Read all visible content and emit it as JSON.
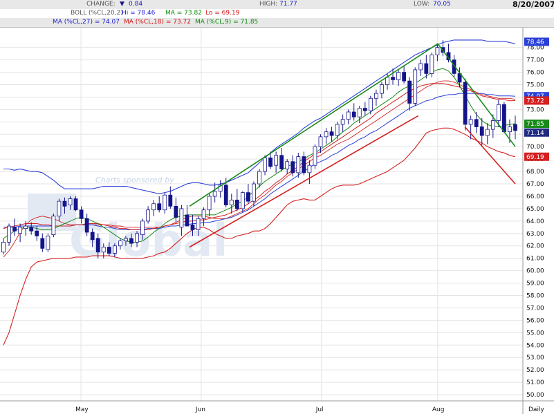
{
  "header": {
    "change_label": "CHANGE:",
    "change_value": "0.84",
    "high_label": "HIGH:",
    "high_value": "71.77",
    "low_label": "LOW:",
    "low_value": "70.05",
    "date": "8/20/2007",
    "boll_label": "BOLL (%CL,20,2)",
    "boll_hi": "Hi = 78.46",
    "boll_ma": "MA = 73.82",
    "boll_lo": "Lo = 69.19",
    "ma27": "MA (%CL,27) = 74.07",
    "ma18": "MA (%CL,18) = 73.72",
    "ma9": "MA (%CL,9) = 71.85"
  },
  "watermark": {
    "sponsor_text": "Charts sponsored by",
    "brand_text": "Global"
  },
  "chart_data": {
    "type": "candlestick",
    "x_labels": [
      "May",
      "Jun",
      "Jul",
      "Aug",
      "Daily"
    ],
    "y_ticks": [
      "50.00",
      "51.00",
      "52.00",
      "53.00",
      "54.00",
      "55.00",
      "56.00",
      "57.00",
      "58.00",
      "59.00",
      "60.00",
      "61.00",
      "62.00",
      "63.00",
      "64.00",
      "65.00",
      "66.00",
      "67.00",
      "68.00",
      "69.00",
      "70.00",
      "71.00",
      "72.00",
      "73.00",
      "74.00",
      "75.00",
      "76.00",
      "77.00",
      "78.00"
    ],
    "ylim": [
      49.5,
      79.6
    ],
    "grid": true,
    "candles": [
      [
        61.5,
        62.6,
        61.3,
        62.3
      ],
      [
        62.3,
        63.8,
        62.0,
        63.6
      ],
      [
        63.5,
        64.2,
        62.8,
        63.2
      ],
      [
        63.0,
        63.8,
        62.3,
        63.5
      ],
      [
        63.4,
        64.0,
        62.8,
        63.6
      ],
      [
        63.5,
        63.9,
        62.9,
        63.2
      ],
      [
        63.2,
        63.6,
        62.4,
        62.8
      ],
      [
        62.6,
        63.0,
        61.5,
        61.8
      ],
      [
        61.7,
        63.0,
        61.5,
        62.8
      ],
      [
        62.9,
        64.6,
        62.7,
        64.4
      ],
      [
        64.4,
        65.8,
        64.0,
        65.6
      ],
      [
        65.6,
        65.9,
        64.6,
        65.2
      ],
      [
        65.3,
        66.0,
        64.9,
        65.8
      ],
      [
        65.8,
        66.0,
        64.8,
        64.9
      ],
      [
        64.9,
        65.2,
        63.8,
        64.2
      ],
      [
        64.2,
        64.6,
        62.8,
        63.1
      ],
      [
        63.1,
        63.4,
        61.9,
        62.5
      ],
      [
        62.6,
        63.0,
        61.0,
        61.5
      ],
      [
        61.5,
        62.2,
        61.0,
        61.9
      ],
      [
        61.9,
        62.3,
        61.2,
        61.4
      ],
      [
        61.4,
        62.2,
        61.1,
        62.0
      ],
      [
        62.0,
        62.6,
        61.7,
        62.4
      ],
      [
        62.4,
        62.8,
        62.0,
        62.6
      ],
      [
        62.6,
        63.0,
        61.9,
        62.2
      ],
      [
        62.3,
        63.2,
        61.9,
        63.0
      ],
      [
        62.9,
        64.2,
        62.5,
        64.0
      ],
      [
        64.0,
        65.2,
        63.8,
        64.9
      ],
      [
        64.9,
        65.7,
        64.4,
        65.4
      ],
      [
        65.4,
        66.0,
        64.7,
        64.9
      ],
      [
        64.9,
        66.3,
        64.6,
        66.1
      ],
      [
        66.1,
        66.8,
        65.0,
        65.2
      ],
      [
        65.2,
        65.9,
        63.9,
        64.3
      ],
      [
        63.5,
        65.3,
        62.8,
        65.0
      ],
      [
        64.5,
        65.3,
        63.8,
        63.6
      ],
      [
        63.7,
        64.5,
        62.8,
        63.3
      ],
      [
        63.3,
        64.4,
        62.8,
        64.2
      ],
      [
        64.2,
        65.1,
        63.6,
        64.9
      ],
      [
        64.9,
        66.2,
        64.4,
        66.0
      ],
      [
        66.0,
        67.1,
        65.5,
        66.4
      ],
      [
        66.4,
        67.3,
        65.9,
        66.9
      ],
      [
        66.9,
        67.5,
        65.1,
        65.3
      ],
      [
        65.3,
        66.2,
        64.6,
        65.7
      ],
      [
        65.7,
        66.6,
        64.8,
        65.0
      ],
      [
        65.0,
        66.4,
        64.7,
        66.3
      ],
      [
        66.3,
        67.0,
        65.4,
        65.6
      ],
      [
        65.6,
        67.2,
        65.2,
        67.0
      ],
      [
        67.0,
        68.2,
        66.7,
        68.0
      ],
      [
        68.0,
        69.3,
        67.7,
        69.1
      ],
      [
        69.1,
        69.6,
        68.2,
        68.4
      ],
      [
        68.5,
        69.6,
        67.9,
        69.3
      ],
      [
        69.3,
        69.9,
        68.0,
        68.2
      ],
      [
        68.2,
        69.0,
        67.8,
        68.8
      ],
      [
        68.8,
        69.3,
        67.6,
        67.9
      ],
      [
        67.9,
        69.5,
        67.5,
        69.2
      ],
      [
        69.2,
        69.6,
        67.7,
        67.9
      ],
      [
        67.9,
        68.9,
        67.0,
        68.5
      ],
      [
        68.5,
        70.2,
        68.2,
        70.0
      ],
      [
        70.0,
        71.0,
        69.5,
        70.8
      ],
      [
        70.8,
        71.5,
        70.2,
        71.2
      ],
      [
        71.2,
        71.6,
        70.4,
        70.9
      ],
      [
        70.9,
        72.0,
        70.6,
        71.8
      ],
      [
        71.8,
        72.6,
        71.2,
        72.2
      ],
      [
        72.2,
        73.0,
        71.8,
        72.8
      ],
      [
        72.8,
        73.5,
        72.1,
        72.4
      ],
      [
        72.4,
        73.3,
        71.9,
        73.1
      ],
      [
        73.1,
        73.6,
        72.5,
        72.9
      ],
      [
        72.9,
        74.1,
        72.6,
        73.9
      ],
      [
        73.9,
        74.6,
        73.3,
        74.3
      ],
      [
        74.3,
        75.2,
        73.9,
        75.0
      ],
      [
        75.0,
        75.9,
        74.6,
        75.6
      ],
      [
        75.6,
        76.3,
        75.0,
        75.4
      ],
      [
        75.4,
        76.2,
        74.9,
        76.0
      ],
      [
        76.0,
        76.5,
        75.1,
        75.3
      ],
      [
        75.3,
        75.6,
        72.9,
        73.5
      ],
      [
        73.5,
        76.4,
        73.3,
        76.2
      ],
      [
        76.2,
        77.0,
        75.7,
        76.7
      ],
      [
        76.7,
        77.4,
        75.5,
        75.9
      ],
      [
        75.9,
        77.6,
        75.6,
        77.4
      ],
      [
        77.4,
        78.2,
        76.9,
        78.0
      ],
      [
        78.0,
        78.6,
        77.3,
        77.6
      ],
      [
        77.6,
        78.3,
        76.8,
        77.0
      ],
      [
        77.0,
        77.4,
        75.6,
        75.9
      ],
      [
        75.9,
        76.4,
        74.8,
        75.2
      ],
      [
        75.2,
        75.5,
        71.3,
        71.8
      ],
      [
        71.8,
        72.5,
        70.6,
        72.2
      ],
      [
        72.2,
        72.8,
        71.1,
        71.6
      ],
      [
        71.6,
        72.3,
        70.0,
        70.9
      ],
      [
        70.9,
        71.9,
        70.2,
        71.4
      ],
      [
        71.4,
        72.6,
        70.7,
        72.1
      ],
      [
        72.1,
        73.8,
        71.6,
        73.4
      ],
      [
        73.4,
        73.6,
        71.1,
        71.2
      ],
      [
        71.2,
        72.2,
        70.3,
        71.6
      ],
      [
        71.8,
        72.5,
        70.6,
        71.3
      ]
    ],
    "series": [
      {
        "name": "BOLL Hi",
        "values": [
          68.2,
          68.2,
          68.1,
          68.2,
          68.1,
          68.0,
          68.0,
          67.9,
          67.6,
          67.3,
          66.9,
          66.6,
          66.6,
          66.6,
          66.6,
          66.6,
          66.6,
          66.7,
          66.8,
          66.8,
          66.8,
          66.8,
          66.8,
          66.7,
          66.6,
          66.5,
          66.4,
          66.3,
          66.2,
          66.3,
          66.4,
          66.6,
          66.8,
          67.0,
          67.1,
          67.1,
          67.0,
          66.9,
          66.9,
          67.0,
          67.1,
          67.3,
          67.5,
          67.7,
          67.9,
          68.3,
          68.7,
          69.1,
          69.5,
          69.9,
          70.2,
          70.5,
          70.8,
          71.1,
          71.5,
          71.8,
          72.1,
          72.3,
          72.6,
          72.9,
          73.2,
          73.5,
          73.8,
          74.1,
          74.4,
          74.7,
          75.0,
          75.3,
          75.6,
          75.9,
          76.2,
          76.5,
          76.8,
          77.1,
          77.4,
          77.6,
          77.8,
          78.0,
          78.2,
          78.4,
          78.5,
          78.6,
          78.6,
          78.6,
          78.6,
          78.6,
          78.6,
          78.5,
          78.5,
          78.5,
          78.5,
          78.4,
          78.3
        ]
      },
      {
        "name": "BOLL Lo",
        "values": [
          54.0,
          55.0,
          56.5,
          58.0,
          59.3,
          60.3,
          60.7,
          60.8,
          60.9,
          61.0,
          61.0,
          61.0,
          61.0,
          61.1,
          61.1,
          61.1,
          61.2,
          61.2,
          61.2,
          61.2,
          61.1,
          61.0,
          61.0,
          61.0,
          61.0,
          61.0,
          61.1,
          61.2,
          61.4,
          61.5,
          61.8,
          62.2,
          62.6,
          63.0,
          63.3,
          63.5,
          63.5,
          63.3,
          63.0,
          62.8,
          62.6,
          62.6,
          62.8,
          62.9,
          63.0,
          63.2,
          63.2,
          63.4,
          63.8,
          64.3,
          64.8,
          65.3,
          65.6,
          65.7,
          65.8,
          65.7,
          65.7,
          66.0,
          66.3,
          66.6,
          66.8,
          66.9,
          66.9,
          66.9,
          67.0,
          67.2,
          67.4,
          67.6,
          67.8,
          68.0,
          68.3,
          68.6,
          68.9,
          69.4,
          69.9,
          70.5,
          71.1,
          71.3,
          71.4,
          71.5,
          71.5,
          71.4,
          71.2,
          71.0,
          70.7,
          70.5,
          70.3,
          70.0,
          69.8,
          69.6,
          69.5,
          69.3,
          69.19
        ]
      },
      {
        "name": "BOLL MA",
        "values": [
          61.1,
          61.6,
          62.3,
          63.1,
          63.7,
          64.1,
          64.3,
          64.4,
          64.3,
          64.2,
          64.0,
          63.8,
          63.7,
          63.7,
          63.7,
          63.7,
          63.7,
          63.7,
          63.7,
          63.7,
          63.6,
          63.6,
          63.5,
          63.5,
          63.5,
          63.5,
          63.5,
          63.5,
          63.5,
          63.6,
          63.7,
          63.9,
          64.1,
          64.3,
          64.4,
          64.4,
          64.4,
          64.3,
          64.2,
          64.2,
          64.2,
          64.4,
          64.6,
          64.8,
          65.0,
          65.4,
          65.8,
          66.1,
          66.5,
          66.9,
          67.2,
          67.6,
          67.9,
          68.2,
          68.5,
          68.8,
          69.1,
          69.3,
          69.6,
          69.9,
          70.2,
          70.4,
          70.6,
          70.9,
          71.2,
          71.5,
          71.8,
          72.1,
          72.4,
          72.7,
          73.0,
          73.3,
          73.6,
          73.9,
          74.2,
          74.5,
          74.8,
          75.0,
          75.2,
          75.3,
          75.3,
          75.2,
          75.0,
          74.8,
          74.6,
          74.4,
          74.2,
          74.1,
          74.0,
          73.9,
          73.9,
          73.9,
          73.82
        ]
      },
      {
        "name": "MA 27",
        "values": [
          63.5,
          63.5,
          63.5,
          63.6,
          63.6,
          63.6,
          63.6,
          63.6,
          63.6,
          63.6,
          63.6,
          63.6,
          63.6,
          63.7,
          63.7,
          63.7,
          63.7,
          63.6,
          63.5,
          63.5,
          63.4,
          63.3,
          63.3,
          63.3,
          63.3,
          63.3,
          63.4,
          63.4,
          63.4,
          63.5,
          63.6,
          63.6,
          63.7,
          63.7,
          63.8,
          63.8,
          63.9,
          63.9,
          64.0,
          64.1,
          64.2,
          64.3,
          64.5,
          64.7,
          64.9,
          65.2,
          65.5,
          65.8,
          66.2,
          66.5,
          66.8,
          67.1,
          67.4,
          67.7,
          68.0,
          68.3,
          68.6,
          68.8,
          69.0,
          69.3,
          69.5,
          69.8,
          70.1,
          70.3,
          70.6,
          70.8,
          71.1,
          71.3,
          71.6,
          71.9,
          72.2,
          72.5,
          72.8,
          73.1,
          73.3,
          73.5,
          73.7,
          73.8,
          74.0,
          74.1,
          74.2,
          74.2,
          74.3,
          74.3,
          74.3,
          74.3,
          74.3,
          74.2,
          74.2,
          74.1,
          74.1,
          74.1,
          74.07
        ]
      },
      {
        "name": "MA 18",
        "values": [
          63.4,
          63.5,
          63.6,
          63.7,
          63.8,
          63.8,
          63.8,
          63.7,
          63.7,
          63.6,
          63.6,
          63.6,
          63.6,
          63.7,
          63.7,
          63.8,
          63.8,
          63.8,
          63.7,
          63.6,
          63.5,
          63.4,
          63.4,
          63.3,
          63.3,
          63.3,
          63.3,
          63.4,
          63.5,
          63.6,
          63.7,
          63.8,
          63.9,
          64.0,
          64.0,
          64.1,
          64.1,
          64.2,
          64.3,
          64.4,
          64.5,
          64.7,
          64.9,
          65.1,
          65.4,
          65.7,
          66.0,
          66.4,
          66.7,
          67.1,
          67.4,
          67.8,
          68.1,
          68.4,
          68.8,
          69.1,
          69.4,
          69.6,
          69.9,
          70.2,
          70.5,
          70.8,
          71.1,
          71.4,
          71.7,
          72.0,
          72.3,
          72.7,
          73.0,
          73.3,
          73.6,
          73.9,
          74.2,
          74.5,
          74.7,
          74.9,
          75.0,
          75.1,
          75.1,
          75.1,
          75.0,
          74.9,
          74.8,
          74.6,
          74.5,
          74.3,
          74.1,
          74.0,
          73.9,
          73.8,
          73.8,
          73.7,
          73.72
        ]
      },
      {
        "name": "MA 9",
        "values": [
          62.6,
          62.9,
          63.2,
          63.4,
          63.5,
          63.5,
          63.4,
          63.3,
          63.3,
          63.4,
          63.6,
          63.8,
          64.0,
          64.2,
          64.3,
          64.2,
          64.0,
          63.8,
          63.5,
          63.2,
          62.9,
          62.6,
          62.4,
          62.3,
          62.3,
          62.4,
          62.7,
          63.1,
          63.4,
          63.8,
          64.1,
          64.3,
          64.4,
          64.5,
          64.5,
          64.5,
          64.5,
          64.5,
          64.5,
          64.7,
          64.9,
          65.1,
          65.4,
          65.6,
          66.0,
          66.4,
          66.8,
          67.2,
          67.5,
          67.8,
          68.1,
          68.4,
          68.6,
          68.8,
          69.0,
          69.3,
          69.5,
          69.8,
          70.1,
          70.4,
          70.8,
          71.2,
          71.5,
          71.9,
          72.2,
          72.5,
          72.8,
          73.1,
          73.4,
          73.7,
          74.0,
          74.4,
          74.7,
          74.9,
          75.1,
          75.4,
          75.7,
          76.0,
          76.2,
          76.3,
          76.1,
          75.6,
          74.9,
          74.1,
          73.3,
          72.6,
          72.1,
          71.8,
          71.6,
          71.6,
          71.7,
          71.8,
          71.85
        ]
      }
    ],
    "trendlines": [
      {
        "color": "#178a17",
        "points": [
          [
            "2007-05-29",
            65.2
          ],
          [
            "2007-08-01",
            78.3
          ],
          [
            "2007-08-21",
            70.0
          ]
        ]
      },
      {
        "color": "#d42020",
        "points": [
          [
            "2007-05-29",
            61.9
          ],
          [
            "2007-07-27",
            72.5
          ]
        ]
      },
      {
        "color": "#d42020",
        "points": [
          [
            "2007-08-08",
            71.6
          ],
          [
            "2007-08-21",
            67.0
          ]
        ]
      }
    ],
    "axis_badges": [
      {
        "text": "78.46",
        "color": "#2a3fd8"
      },
      {
        "text": "74.07",
        "color": "#2a3fd8"
      },
      {
        "text": "73.72",
        "color": "#d42020"
      },
      {
        "text": "71.85",
        "color": "#178a17"
      },
      {
        "text": "71.14",
        "color": "#202a80"
      },
      {
        "text": "69.19",
        "color": "#d42020"
      }
    ],
    "colors": {
      "up_candle": "#ffffff",
      "down_candle": "#14148a",
      "boll_band": "#2a3fd8",
      "boll_lo": "#d42020",
      "ma27": "#2a3fd8",
      "ma18": "#d42020",
      "ma9": "#178a17",
      "grid": "#e4e4e4"
    }
  }
}
